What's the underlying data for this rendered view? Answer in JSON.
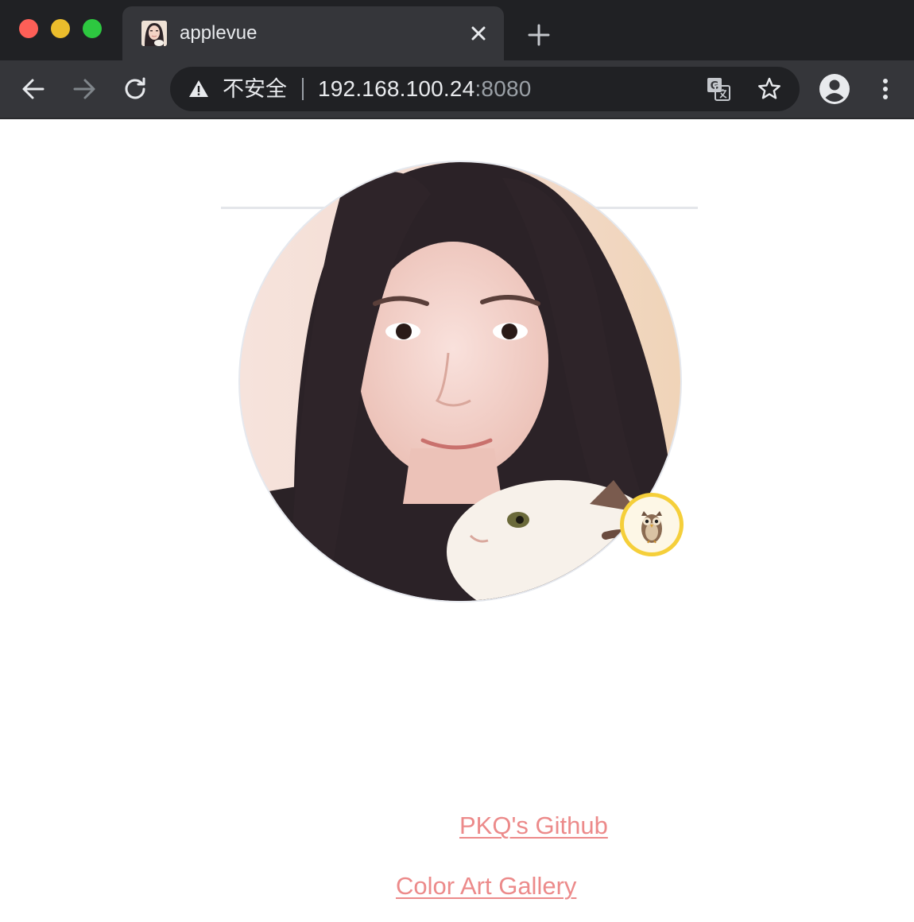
{
  "window": {
    "traffic_lights": {
      "close_color": "#fe5f57",
      "minimize_color": "#ebbd2c",
      "zoom_color": "#2dc840"
    }
  },
  "tab": {
    "title": "applevue",
    "favicon": "profile-photo-favicon",
    "close_icon": "close-icon"
  },
  "newtab_icon": "plus-icon",
  "toolbar": {
    "back_icon": "back-arrow-icon",
    "forward_icon": "forward-arrow-icon",
    "reload_icon": "reload-icon",
    "security_warning_icon": "warning-triangle-icon",
    "security_label": "不安全",
    "url_host": "192.168.100.24",
    "url_port": ":8080",
    "translate_icon": "translate-icon",
    "bookmark_icon": "star-icon",
    "profile_icon": "account-icon",
    "menu_icon": "more-vert-icon"
  },
  "page": {
    "avatar": "profile-photo-woman-with-cat",
    "badge": "owl-icon",
    "links": {
      "github": "PKQ's Github",
      "gallery": "Color Art Gallery"
    },
    "colors": {
      "link": "#ec8a8a",
      "badge_ring": "#f5cf3a",
      "divider": "#e4e6ea"
    }
  }
}
